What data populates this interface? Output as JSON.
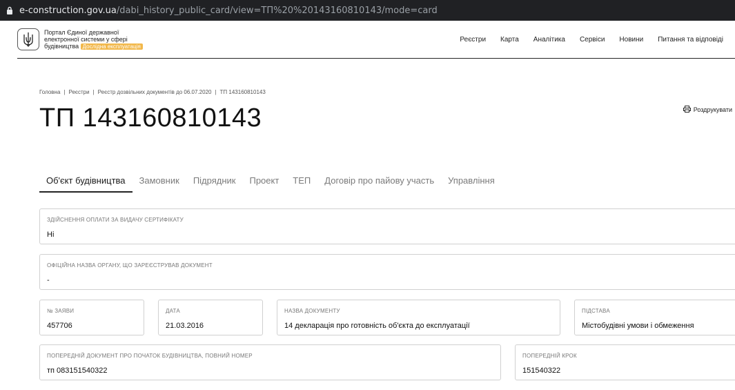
{
  "browser": {
    "url_host": "e-construction.gov.ua",
    "url_path": "/dabi_history_public_card/view=ТП%20%20143160810143/mode=card"
  },
  "header": {
    "brand_line1": "Портал Єдиної державної",
    "brand_line2": "електронної системи у сфері",
    "brand_line3": "будівництва",
    "badge": "Дослідна експлуатація",
    "nav": [
      "Реєстри",
      "Карта",
      "Аналітика",
      "Сервіси",
      "Новини",
      "Питання та відповіді"
    ]
  },
  "breadcrumb": [
    "Головна",
    "Реєстри",
    "Реєстр дозвільних документів до 06.07.2020",
    "ТП 143160810143"
  ],
  "page": {
    "title": "ТП 143160810143",
    "print_label": "Роздрукувати"
  },
  "tabs": [
    "Об'єкт будівництва",
    "Замовник",
    "Підрядник",
    "Проект",
    "ТЕП",
    "Договір про пайову участь",
    "Управління"
  ],
  "fields": {
    "payment": {
      "label": "Здійснення оплати за видачу сертифікату",
      "value": "Ні"
    },
    "authority": {
      "label": "Офіційна назва органу, що зареєстрував документ",
      "value": "-"
    },
    "app_number": {
      "label": "№ заяви",
      "value": "457706"
    },
    "date": {
      "label": "Дата",
      "value": "21.03.2016"
    },
    "doc_name": {
      "label": "Назва документу",
      "value": "14 декларація про готовність об'єкта до експлуатації"
    },
    "basis": {
      "label": "Підстава",
      "value": "Містобудівні умови і обмеження"
    },
    "prev_doc": {
      "label": "Попередній документ про початок будівництва, повний номер",
      "value": "тп 083151540322"
    },
    "prev_step": {
      "label": "Попередній крок",
      "value": "151540322"
    }
  }
}
